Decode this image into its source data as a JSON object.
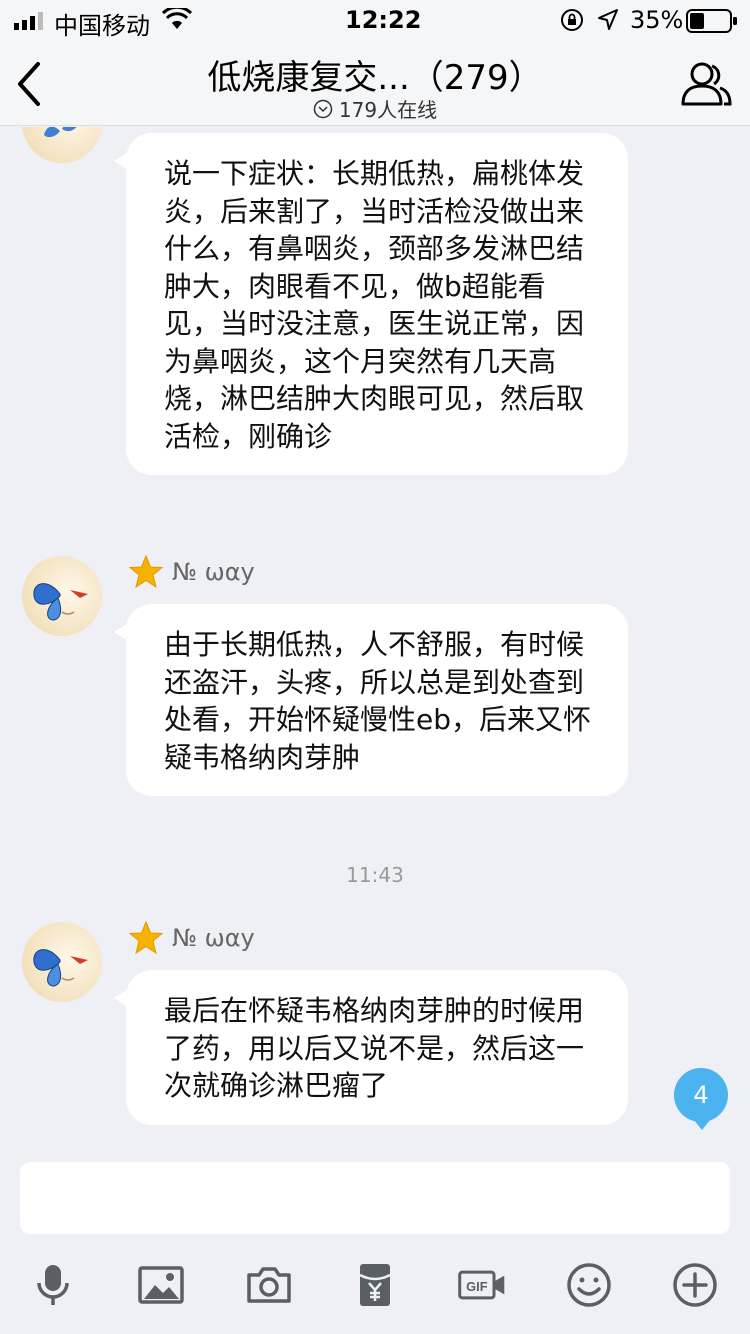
{
  "status_bar": {
    "carrier": "中国移动",
    "time": "12:22",
    "battery": "35%",
    "icons": [
      "signal-icon",
      "wifi-icon",
      "rotation-lock-icon",
      "location-icon",
      "battery-icon"
    ]
  },
  "nav": {
    "title": "低烧康复交...（279）",
    "online": "179人在线",
    "icons": [
      "back-icon",
      "members-icon"
    ]
  },
  "messages": [
    {
      "sender": "",
      "text": "说一下症状：长期低热，扁桃体发炎，后来割了，当时活检没做出来什么，有鼻咽炎，颈部多发淋巴结肿大，肉眼看不见，做b超能看见，当时没注意，医生说正常，因为鼻咽炎，这个月突然有几天高烧，淋巴结肿大肉眼可见，然后取活检，刚确诊"
    },
    {
      "sender": "№ ωαу",
      "text": "由于长期低热，人不舒服，有时候还盗汗，头疼，所以总是到处查到处看，开始怀疑慢性eb，后来又怀疑韦格纳肉芽肿"
    },
    {
      "timestamp": "11:43"
    },
    {
      "sender": "№ ωαу",
      "text": "最后在怀疑韦格纳肉芽肿的时候用了药，用以后又说不是，然后这一次就确诊淋巴瘤了"
    }
  ],
  "unread_count": "4",
  "input": {
    "placeholder": ""
  },
  "toolbar": {
    "icons": [
      "microphone-icon",
      "image-icon",
      "camera-icon",
      "red-packet-icon",
      "gif-icon",
      "emoji-icon",
      "plus-icon"
    ]
  },
  "colors": {
    "background": "#eef0f5",
    "bubble": "#ffffff",
    "unread_badge": "#4bb3ef",
    "icon": "#555555"
  }
}
